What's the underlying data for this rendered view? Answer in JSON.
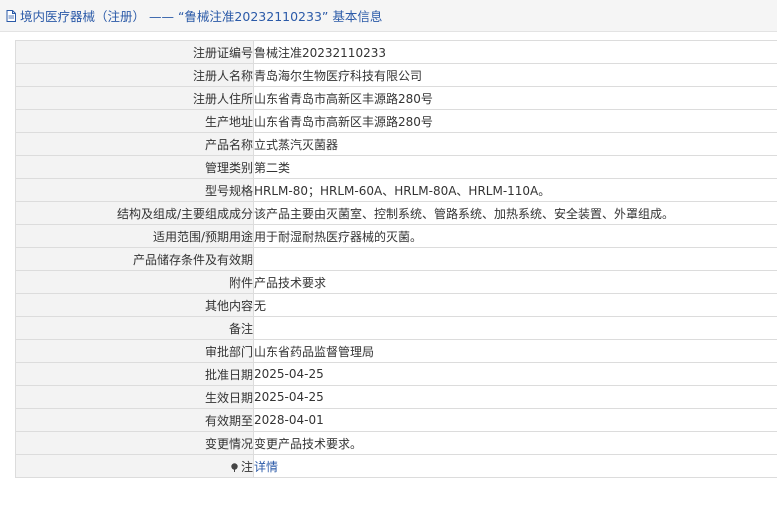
{
  "header": {
    "title": "境内医疗器械（注册） —— “鲁械注准20232110233” 基本信息"
  },
  "rows": [
    {
      "label": "注册证编号",
      "value": "鲁械注准20232110233"
    },
    {
      "label": "注册人名称",
      "value": "青岛海尔生物医疗科技有限公司"
    },
    {
      "label": "注册人住所",
      "value": "山东省青岛市高新区丰源路280号"
    },
    {
      "label": "生产地址",
      "value": "山东省青岛市高新区丰源路280号"
    },
    {
      "label": "产品名称",
      "value": "立式蒸汽灭菌器"
    },
    {
      "label": "管理类别",
      "value": "第二类"
    },
    {
      "label": "型号规格",
      "value": "HRLM-80；HRLM-60A、HRLM-80A、HRLM-110A。"
    },
    {
      "label": "结构及组成/主要组成成分",
      "value": "该产品主要由灭菌室、控制系统、管路系统、加热系统、安全装置、外罩组成。"
    },
    {
      "label": "适用范围/预期用途",
      "value": "用于耐湿耐热医疗器械的灭菌。"
    },
    {
      "label": "产品储存条件及有效期",
      "value": ""
    },
    {
      "label": "附件",
      "value": "产品技术要求"
    },
    {
      "label": "其他内容",
      "value": "无"
    },
    {
      "label": "备注",
      "value": ""
    },
    {
      "label": "审批部门",
      "value": "山东省药品监督管理局"
    },
    {
      "label": "批准日期",
      "value": "2025-04-25"
    },
    {
      "label": "生效日期",
      "value": "2025-04-25"
    },
    {
      "label": "有效期至",
      "value": "2028-04-01"
    },
    {
      "label": "变更情况",
      "value": "变更产品技术要求。"
    }
  ],
  "note_row": {
    "label": "注",
    "link": "详情",
    "icon": "pin-icon"
  }
}
